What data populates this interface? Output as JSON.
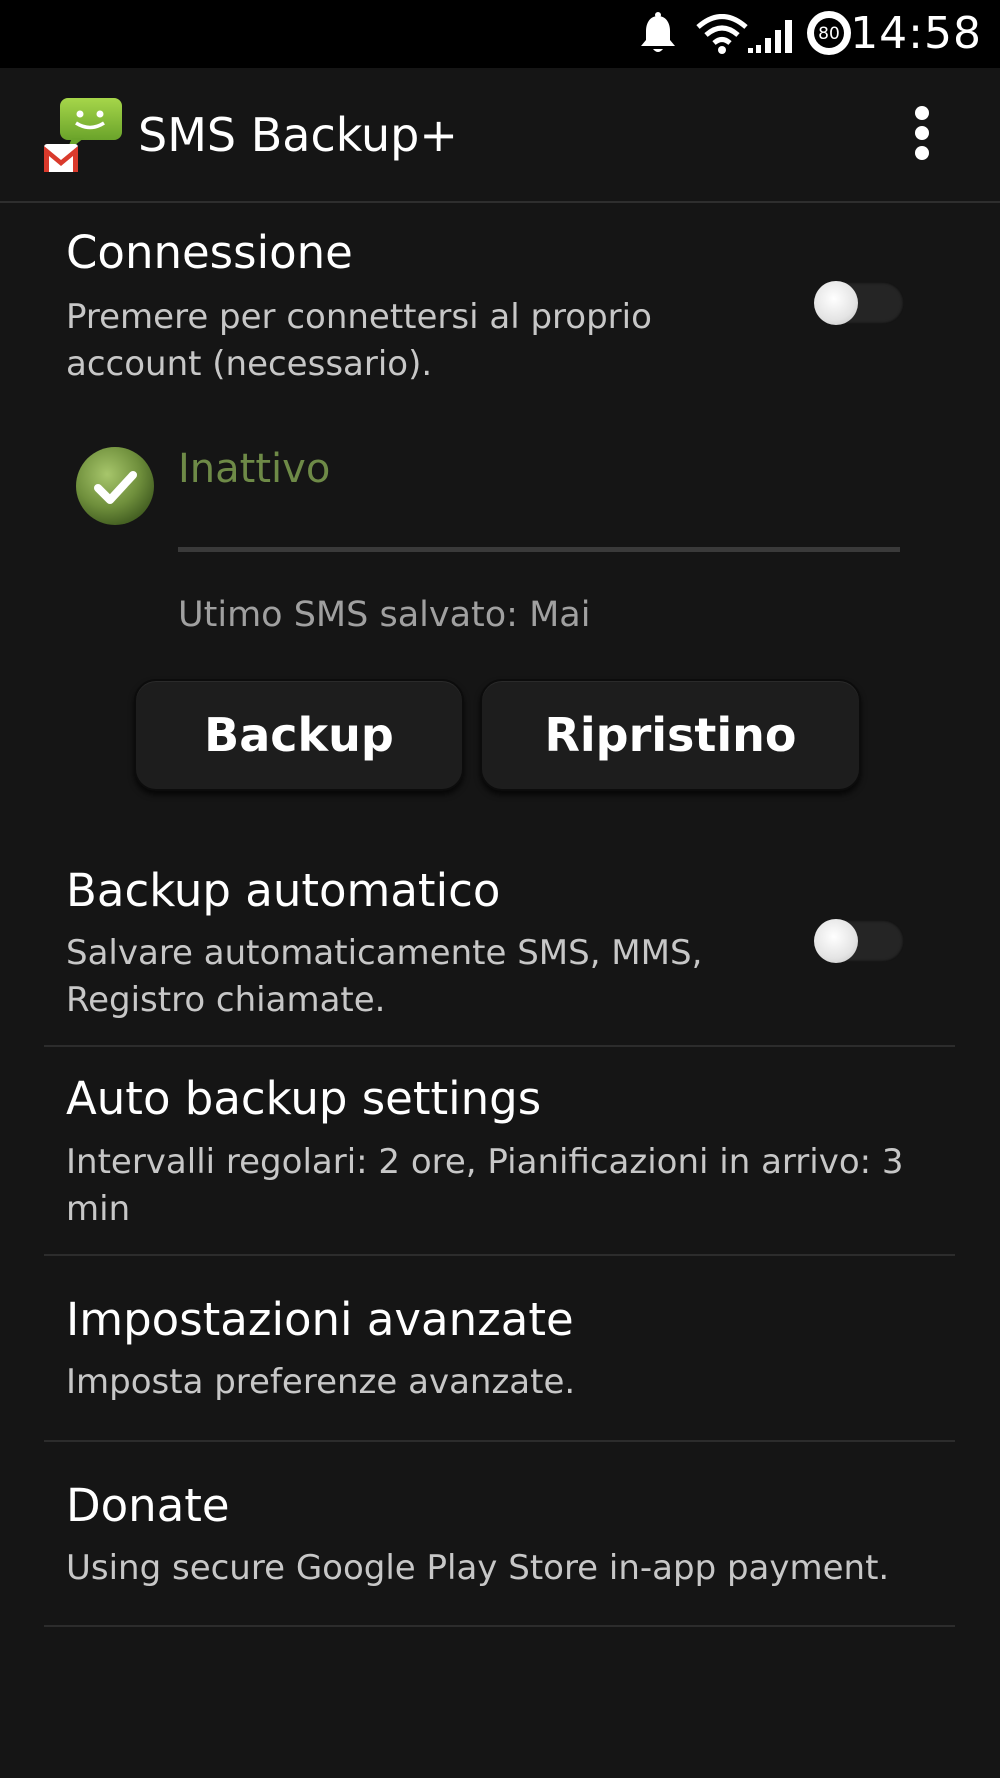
{
  "status_bar": {
    "time": "14:58",
    "battery_level": "80",
    "icons": [
      "notification-bell-icon",
      "wifi-icon",
      "signal-icon",
      "battery-icon"
    ]
  },
  "action_bar": {
    "title": "SMS Backup+",
    "logo_icon": "sms-backup-logo-icon",
    "overflow_icon": "overflow-menu-icon"
  },
  "prefs": {
    "connection": {
      "title": "Connessione",
      "summary": "Premere per connettersi al proprio account (necessario).",
      "enabled": false
    },
    "status": {
      "state": "Inattivo",
      "last_sms": "Utimo SMS salvato: Mai",
      "icon": "check-circle-icon"
    },
    "buttons": {
      "backup": "Backup",
      "restore": "Ripristino"
    },
    "auto_backup": {
      "title": "Backup automatico",
      "summary": "Salvare automaticamente SMS, MMS, Registro chiamate.",
      "enabled": false
    },
    "auto_backup_settings": {
      "title": "Auto backup settings",
      "summary": "Intervalli regolari: 2 ore, Pianificazioni in arrivo: 3 min"
    },
    "advanced": {
      "title": "Impostazioni avanzate",
      "summary": "Imposta preferenze avanzate."
    },
    "donate": {
      "title": "Donate",
      "summary": "Using secure Google Play Store in-app payment."
    }
  },
  "colors": {
    "background": "#151515",
    "status_ok": "#6e8a47",
    "summary_text": "#c7c7c7"
  }
}
